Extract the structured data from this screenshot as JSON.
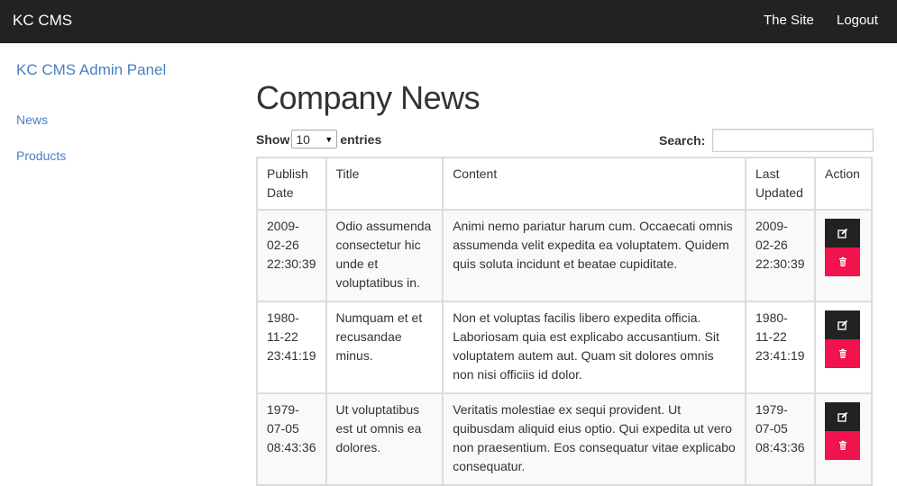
{
  "navbar": {
    "brand": "KC CMS",
    "links": [
      "The Site",
      "Logout"
    ]
  },
  "sidebar": {
    "title": "KC CMS Admin Panel",
    "items": [
      "News",
      "Products"
    ]
  },
  "page": {
    "title": "Company News"
  },
  "table_controls": {
    "show_label": "Show",
    "page_length": "10",
    "entries_label": "entries",
    "search_label": "Search:",
    "search_value": ""
  },
  "table": {
    "headers": [
      "Publish Date",
      "Title",
      "Content",
      "Last Updated",
      "Action"
    ],
    "rows": [
      {
        "publish_date": "2009-02-26 22:30:39",
        "title": "Odio assumenda consectetur hic unde et voluptatibus in.",
        "content": "Animi nemo pariatur harum cum. Occaecati omnis assumenda velit expedita ea voluptatem. Quidem quis soluta incidunt et beatae cupiditate.",
        "last_updated": "2009-02-26 22:30:39"
      },
      {
        "publish_date": "1980-11-22 23:41:19",
        "title": "Numquam et et recusandae minus.",
        "content": "Non et voluptas facilis libero expedita officia. Laboriosam quia est explicabo accusantium. Sit voluptatem autem aut. Quam sit dolores omnis non nisi officiis id dolor.",
        "last_updated": "1980-11-22 23:41:19"
      },
      {
        "publish_date": "1979-07-05 08:43:36",
        "title": "Ut voluptatibus est ut omnis ea dolores.",
        "content": "Veritatis molestiae ex sequi provident. Ut quibusdam aliquid eius optio. Qui expedita ut vero non praesentium. Eos consequatur vitae explicabo consequatur.",
        "last_updated": "1979-07-05 08:43:36"
      }
    ],
    "action_icons": [
      "edit-icon",
      "trash-icon"
    ]
  },
  "colors": {
    "navbar_bg": "#222222",
    "link": "#4a7fc1",
    "delete_button": "#f0134d",
    "edit_button": "#222222"
  }
}
